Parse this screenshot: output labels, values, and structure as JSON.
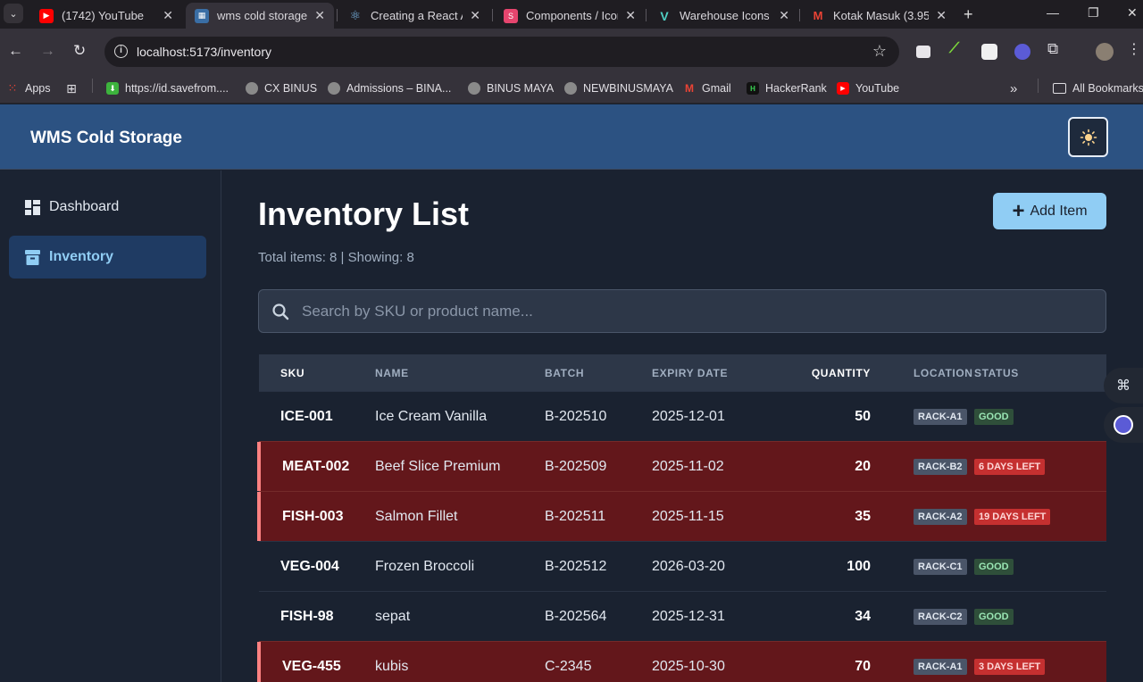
{
  "browser": {
    "tabs": [
      {
        "title": "(1742) YouTube",
        "active": false
      },
      {
        "title": "wms cold storage",
        "active": true
      },
      {
        "title": "Creating a React A",
        "active": false
      },
      {
        "title": "Components / Icon",
        "active": false
      },
      {
        "title": "Warehouse Icons &",
        "active": false
      },
      {
        "title": "Kotak Masuk (3.95",
        "active": false
      }
    ],
    "url": "localhost:5173/inventory",
    "bookmarks": [
      {
        "label": "Apps"
      },
      {
        "label": "https://id.savefrom...."
      },
      {
        "label": "CX BINUS"
      },
      {
        "label": "Admissions – BINA..."
      },
      {
        "label": "BINUS MAYA"
      },
      {
        "label": "NEWBINUSMAYA"
      },
      {
        "label": "Gmail"
      },
      {
        "label": "HackerRank"
      },
      {
        "label": "YouTube"
      }
    ],
    "all_bookmarks": "All Bookmarks"
  },
  "app": {
    "brand": "WMS Cold Storage",
    "sidebar": [
      {
        "label": "Dashboard",
        "active": false
      },
      {
        "label": "Inventory",
        "active": true
      }
    ],
    "page_title": "Inventory List",
    "summary": "Total items: 8 | Showing: 8",
    "add_button": "Add Item",
    "search_placeholder": "Search by SKU or product name...",
    "columns": [
      "SKU",
      "NAME",
      "BATCH",
      "EXPIRY DATE",
      "QUANTITY",
      "LOCATION",
      "STATUS"
    ],
    "rows": [
      {
        "sku": "ICE-001",
        "name": "Ice Cream Vanilla",
        "batch": "B-202510",
        "expiry": "2025-12-01",
        "quantity": "50",
        "location": "RACK-A1",
        "status": "GOOD",
        "alert": false
      },
      {
        "sku": "MEAT-002",
        "name": "Beef Slice Premium",
        "batch": "B-202509",
        "expiry": "2025-11-02",
        "quantity": "20",
        "location": "RACK-B2",
        "status": "6 DAYS LEFT",
        "alert": true
      },
      {
        "sku": "FISH-003",
        "name": "Salmon Fillet",
        "batch": "B-202511",
        "expiry": "2025-11-15",
        "quantity": "35",
        "location": "RACK-A2",
        "status": "19 DAYS LEFT",
        "alert": true
      },
      {
        "sku": "VEG-004",
        "name": "Frozen Broccoli",
        "batch": "B-202512",
        "expiry": "2026-03-20",
        "quantity": "100",
        "location": "RACK-C1",
        "status": "GOOD",
        "alert": false
      },
      {
        "sku": "FISH-98",
        "name": "sepat",
        "batch": "B-202564",
        "expiry": "2025-12-31",
        "quantity": "34",
        "location": "RACK-C2",
        "status": "GOOD",
        "alert": false
      },
      {
        "sku": "VEG-455",
        "name": "kubis",
        "batch": "C-2345",
        "expiry": "2025-10-30",
        "quantity": "70",
        "location": "RACK-A1",
        "status": "3 DAYS LEFT",
        "alert": true
      }
    ]
  },
  "colors": {
    "header_bg": "#2c5282",
    "accent": "#90cdf4",
    "alert_row": "#63171b",
    "alert_badge": "#c53030",
    "good_badge": "#2f4f3a"
  }
}
